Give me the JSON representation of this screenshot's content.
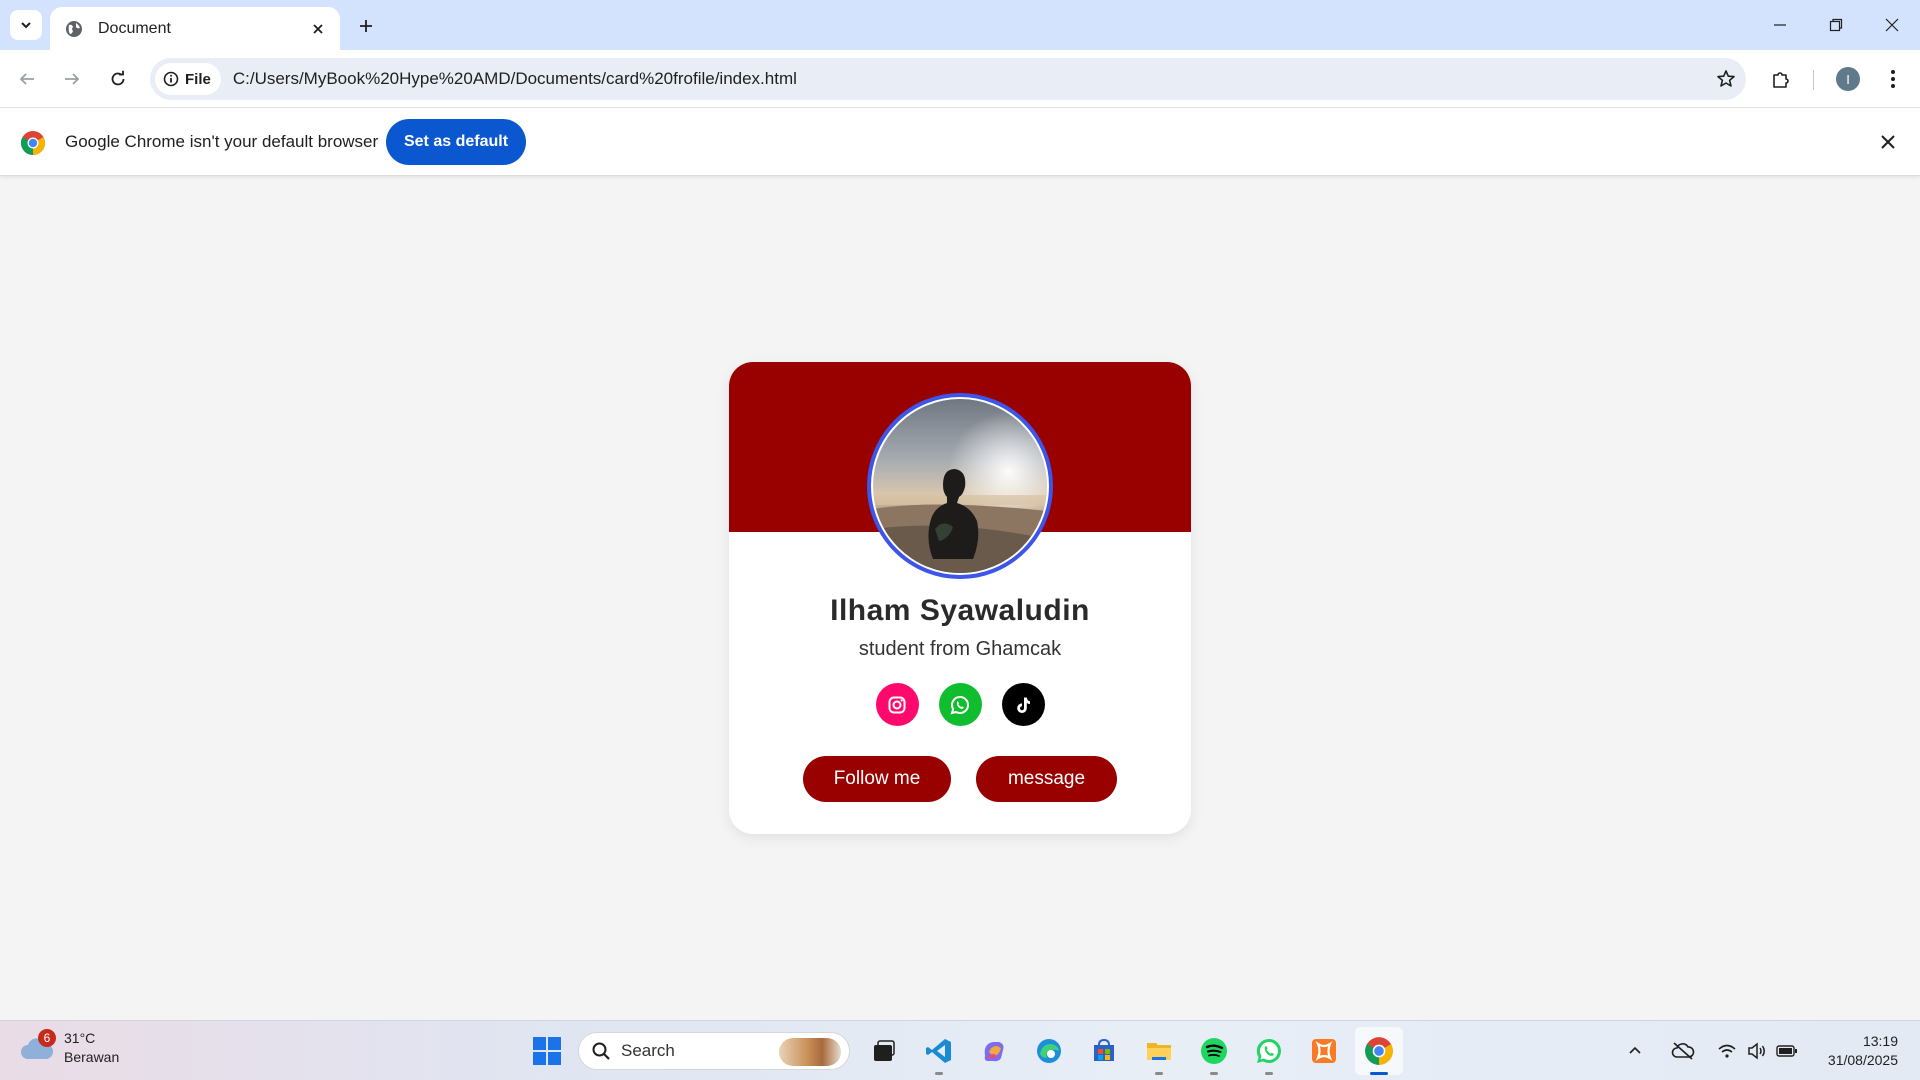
{
  "browser": {
    "tab_title": "Document",
    "address_chip": "File",
    "url": "C:/Users/MyBook%20Hype%20AMD/Documents/card%20frofile/index.html",
    "profile_initial": "I"
  },
  "infobar": {
    "message": "Google Chrome isn't your default browser",
    "button_label": "Set as default"
  },
  "profile": {
    "name": "Ilham Syawaludin",
    "bio": "student from Ghamcak",
    "socials": [
      {
        "name": "instagram",
        "color": "#ff0a6c"
      },
      {
        "name": "whatsapp",
        "color": "#10bd2e"
      },
      {
        "name": "tiktok",
        "color": "#000000"
      }
    ],
    "follow_label": "Follow me",
    "message_label": "message",
    "accent_color": "#990000",
    "photo_border_color": "#3d55e8"
  },
  "taskbar": {
    "weather_badge": "6",
    "temperature": "31°C",
    "weather_desc": "Berawan",
    "search_placeholder": "Search",
    "time": "13:19",
    "date": "31/08/2025"
  }
}
